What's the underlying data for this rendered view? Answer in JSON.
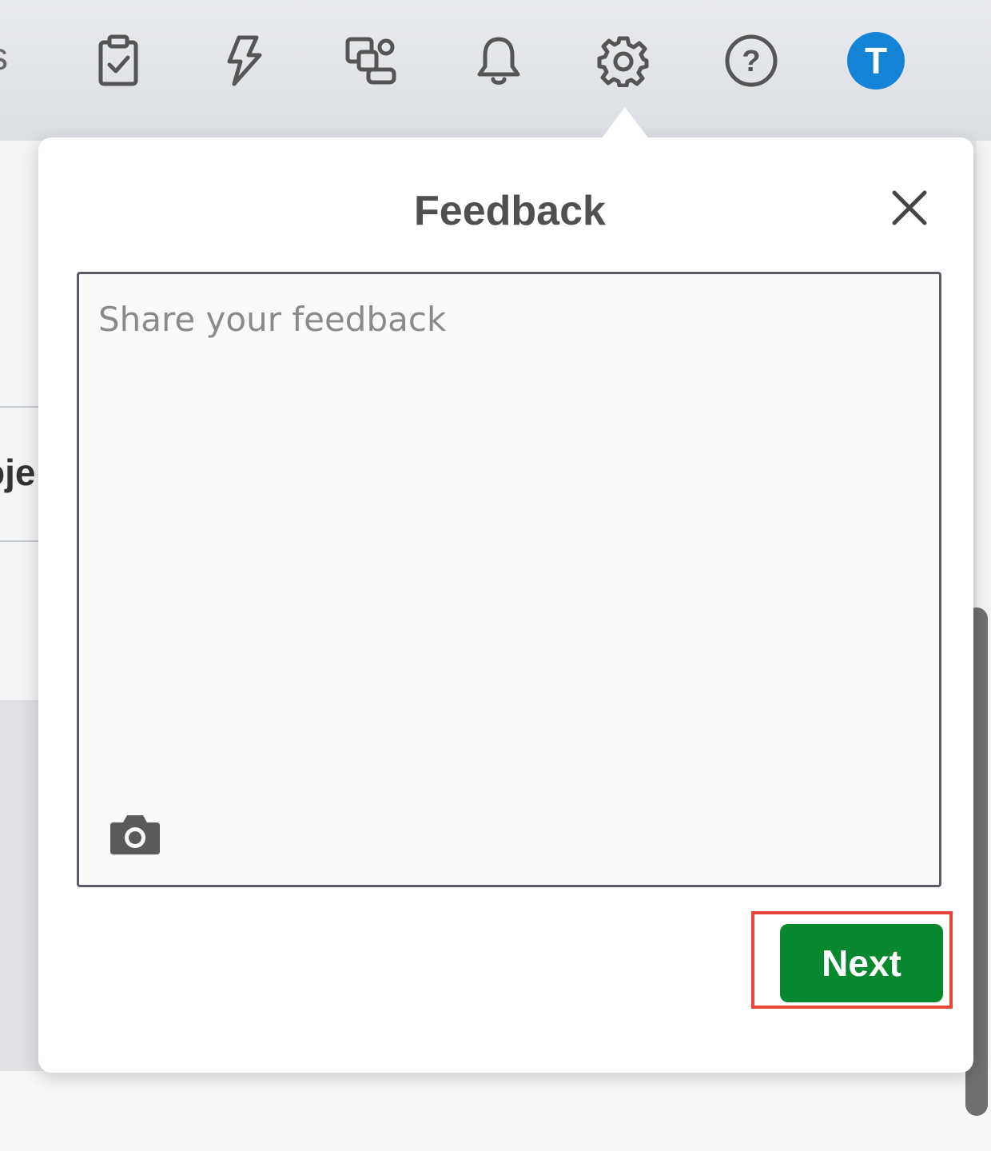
{
  "toolbar": {
    "edge_text": "s",
    "icons": [
      "clipboard-check-icon",
      "lightning-icon",
      "apps-switcher-icon",
      "bell-icon",
      "gear-icon",
      "help-icon",
      "avatar"
    ],
    "avatar_initial": "T",
    "avatar_color": "#1584d6"
  },
  "background": {
    "edge_word": "oje"
  },
  "feedback": {
    "title": "Feedback",
    "placeholder": "Share your feedback",
    "next_label": "Next",
    "next_color": "#07882f",
    "highlight_color": "#e8463d"
  }
}
